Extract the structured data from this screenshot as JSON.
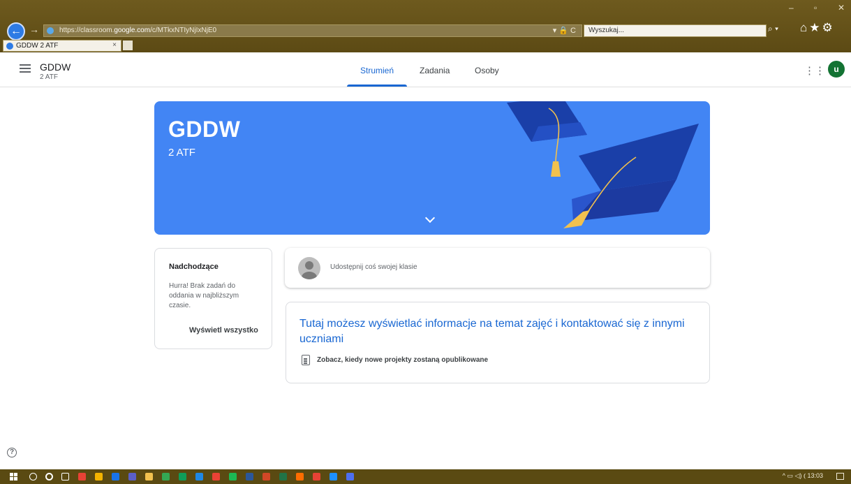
{
  "browser": {
    "url_prefix": "https://classroom.",
    "url_host": "google.com",
    "url_path": "/c/MTkxNTIyNjIxNjE0",
    "search_placeholder": "Wyszukaj...",
    "tab_title": "GDDW 2 ATF",
    "tab_close": "×",
    "addr_tools": "▾ 🔒 C",
    "search_glyph": "⌕ ▾",
    "toolbar_glyphs": "⌂★⚙",
    "win_minimize": "–",
    "win_restore": "▫",
    "win_close": "✕"
  },
  "header": {
    "class_name": "GDDW",
    "section": "2 ATF",
    "tabs": [
      {
        "label": "Strumień",
        "active": true
      },
      {
        "label": "Zadania",
        "active": false
      },
      {
        "label": "Osoby",
        "active": false
      }
    ],
    "apps_glyph": "⋮⋮⋮",
    "avatar_letter": "u",
    "avatar_color": "#137333"
  },
  "banner": {
    "title": "GDDW",
    "subtitle": "2 ATF",
    "color": "#4285f4"
  },
  "upcoming": {
    "title": "Nadchodzące",
    "text": "Hurra! Brak zadań do oddania w najbliższym czasie.",
    "link": "Wyświetl wszystko"
  },
  "share": {
    "placeholder": "Udostępnij coś swojej klasie"
  },
  "info": {
    "title": "Tutaj możesz wyświetlać informacje na temat zajęć i kontaktować się z innymi uczniami",
    "subtitle": "Zobacz, kiedy nowe projekty zostaną opublikowane"
  },
  "help": {
    "glyph": "?"
  },
  "taskbar": {
    "clock": "13:03",
    "tray_glyphs": "^ ▭ ◁) ⦅"
  }
}
